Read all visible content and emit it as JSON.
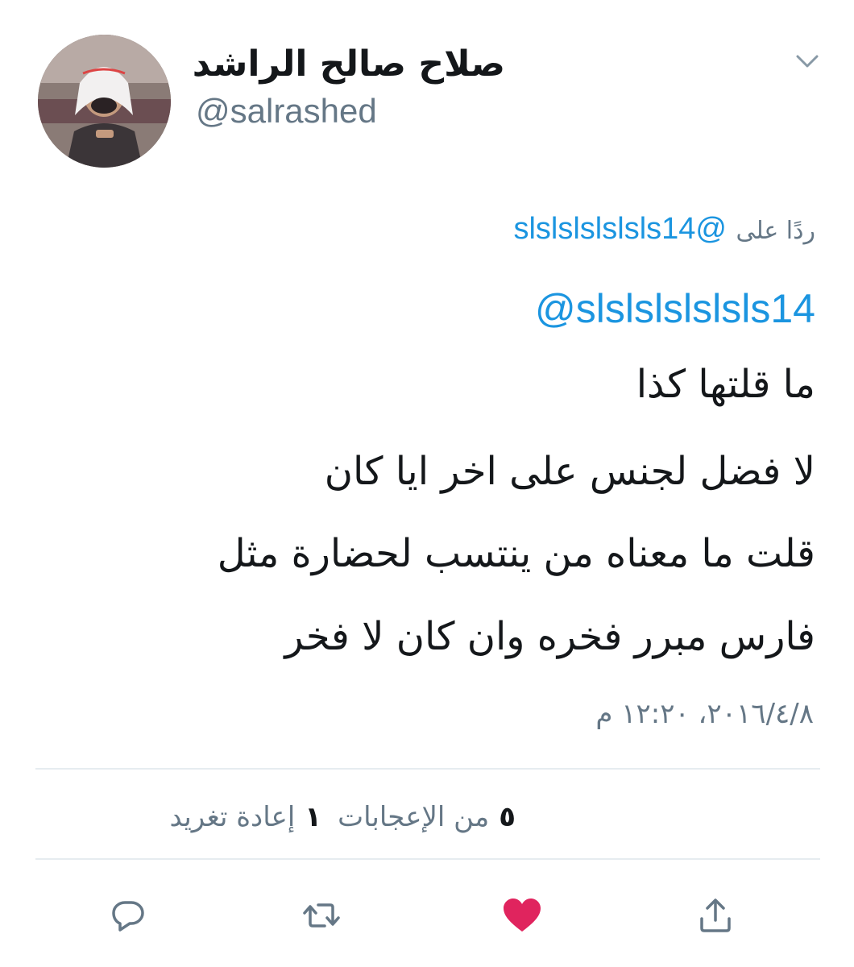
{
  "author": {
    "display_name": "صلاح صالح الراشد",
    "handle": "@salrashed"
  },
  "reply": {
    "label": "ردًا على",
    "target": "@slslslslslsls14"
  },
  "tweet": {
    "mention": "@slslslslslsls14",
    "lines": [
      "ما قلتها كذا",
      "لا فضل لجنس على اخر ايا كان",
      "قلت ما معناه من ينتسب لحضارة مثل",
      "فارس مبرر فخره وان كان لا فخر"
    ],
    "timestamp": "٢٠١٦/٤/٨، ١٢:٢٠ م"
  },
  "stats": {
    "retweets_count": "١",
    "retweets_label": "إعادة تغريد",
    "likes_count": "٥",
    "likes_label": "من الإعجابات"
  },
  "actions": {
    "reply_icon": "reply-icon",
    "retweet_icon": "retweet-icon",
    "like_icon": "heart-icon",
    "share_icon": "share-icon"
  },
  "colors": {
    "link": "#1b95e0",
    "secondary_text": "#657786",
    "like_active": "#e0245e",
    "divider": "#e6ecf0"
  }
}
